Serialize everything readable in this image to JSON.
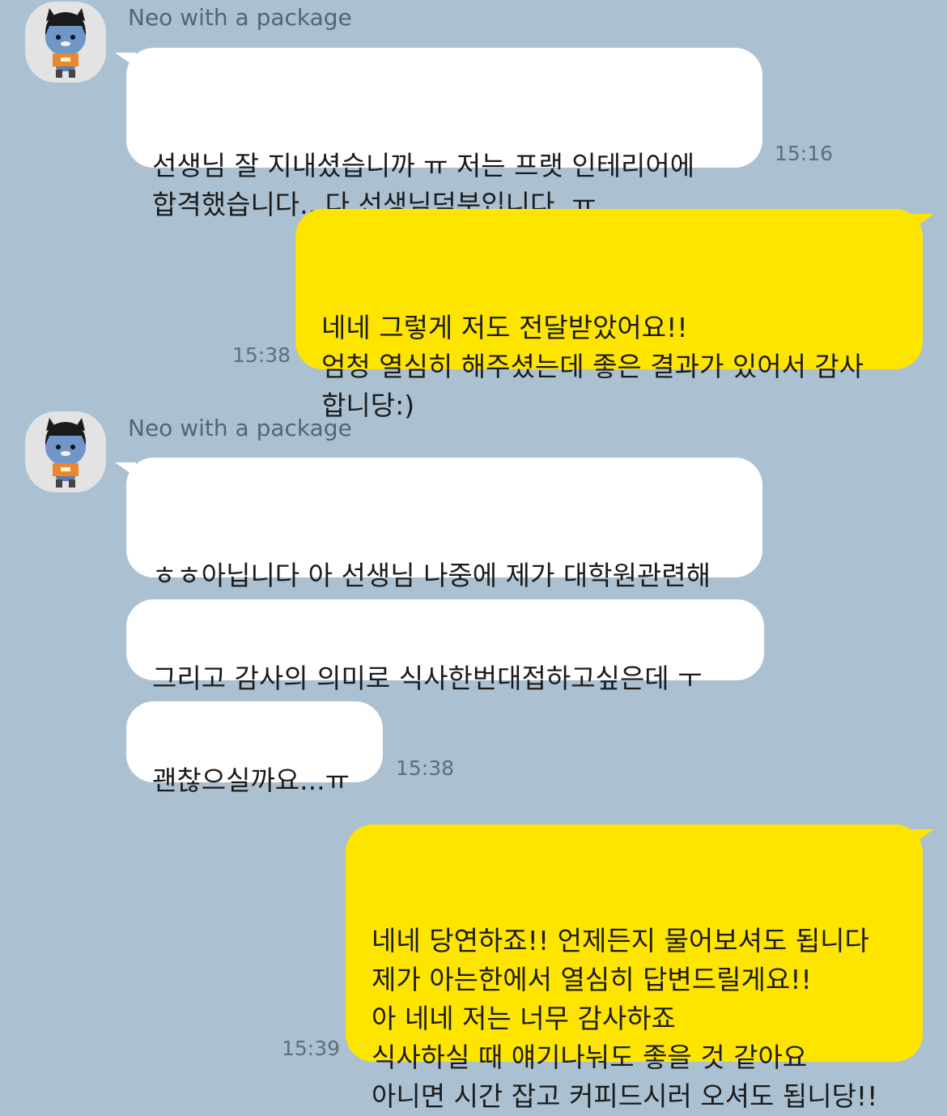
{
  "contact": {
    "name": "Neo with a package",
    "avatar_icon": "neo-character-avatar"
  },
  "colors": {
    "background": "#abc1d1",
    "incoming_bubble": "#ffffff",
    "outgoing_bubble": "#fee500"
  },
  "messages": [
    {
      "direction": "incoming",
      "text": "선생님 잘 지내셨습니까 ㅠ 저는 프랫 인테리어에\n합격했습니다...다 선생님덕분입니다..ㅠ",
      "time": "15:16"
    },
    {
      "direction": "outgoing",
      "text": "네네 그렇게 저도 전달받았어요!!\n엄청 열심히 해주셨는데 좋은 결과가 있어서 감사\n합니당:)",
      "time": "15:38"
    },
    {
      "direction": "incoming",
      "text": "ㅎㅎ아닙니다 아 선생님 나중에 제가 대학원관련해\n서 좀 여쭤봐도될까요?ㅠ"
    },
    {
      "direction": "incoming",
      "text": "그리고 감사의 의미로 식사한번대접하고싶은데 ㅜ"
    },
    {
      "direction": "incoming",
      "text": "괜찮으실까요...ㅠ",
      "time": "15:38"
    },
    {
      "direction": "outgoing",
      "text": "네네 당연하죠!! 언제든지 물어보셔도 됩니다\n제가 아는한에서 열심히 답변드릴게요!!\n아 네네 저는 너무 감사하죠\n식사하실 때 얘기나눠도 좋을 것 같아요\n아니면 시간 잡고 커피드시러 오셔도 됩니당!!",
      "time": "15:39"
    }
  ]
}
